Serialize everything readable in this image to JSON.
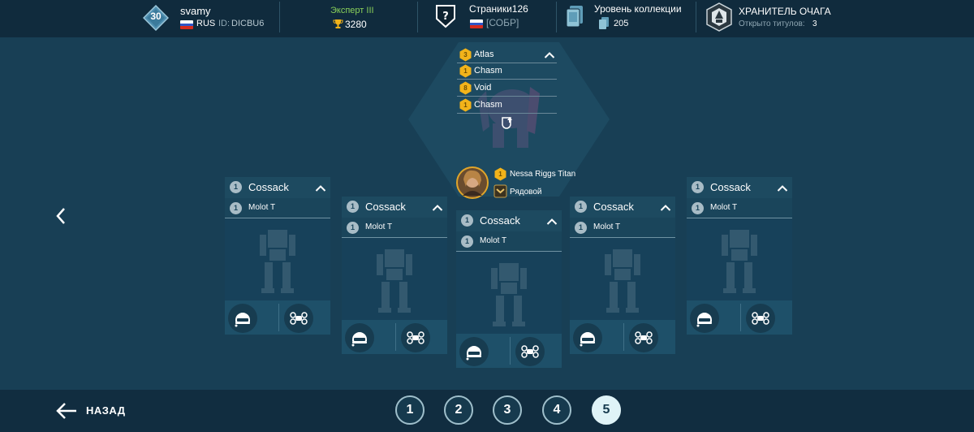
{
  "header": {
    "player": {
      "level": "30",
      "name": "svamy",
      "country": "RUS",
      "id_label": "ID:",
      "id_value": "DICBU6"
    },
    "league": {
      "name": "Эксперт III",
      "trophies": "3280"
    },
    "clan": {
      "name": "Страники126",
      "tag": "[СОБР]"
    },
    "collection": {
      "label": "Уровень коллекции",
      "value": "205"
    },
    "title": {
      "name": "ХРАНИТЕЛЬ ОЧАГА",
      "subtitle": "Открыто титулов:",
      "count": "3"
    }
  },
  "pilot_panel": {
    "modules": [
      {
        "level": "3",
        "name": "Atlas"
      },
      {
        "level": "1",
        "name": "Chasm"
      },
      {
        "level": "8",
        "name": "Void"
      },
      {
        "level": "1",
        "name": "Chasm"
      }
    ],
    "pilot": {
      "level": "1",
      "name": "Nessa Riggs Titan",
      "rank": "Рядовой"
    },
    "icons": {
      "collapse": "chevron-up-icon",
      "upgrade": "shield-upgrade-icon"
    }
  },
  "hangars": [
    {
      "robot": "Cossack",
      "robot_level": "1",
      "weapon": "Molot T",
      "weapon_level": "1"
    },
    {
      "robot": "Cossack",
      "robot_level": "1",
      "weapon": "Molot T",
      "weapon_level": "1"
    },
    {
      "robot": "Cossack",
      "robot_level": "1",
      "weapon": "Molot T",
      "weapon_level": "1"
    },
    {
      "robot": "Cossack",
      "robot_level": "1",
      "weapon": "Molot T",
      "weapon_level": "1"
    },
    {
      "robot": "Cossack",
      "robot_level": "1",
      "weapon": "Molot T",
      "weapon_level": "1"
    }
  ],
  "navigation": {
    "back_label": "НАЗАД",
    "pages": [
      "1",
      "2",
      "3",
      "4",
      "5"
    ],
    "active_page": "5"
  },
  "colors": {
    "background": "#183f55",
    "topbar": "#102b3d",
    "league_green": "#8ad05a",
    "module_gold": "#f2b31a",
    "text_muted": "#8fa7b3"
  }
}
